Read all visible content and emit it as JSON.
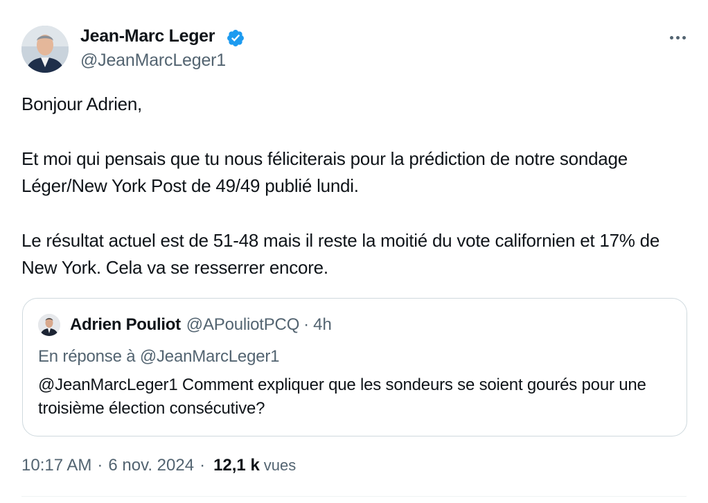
{
  "author": {
    "name": "Jean-Marc Leger",
    "handle": "@JeanMarcLeger1",
    "avatar_icon": "profile-photo",
    "verified_icon": "verified-badge-icon",
    "verified_color": "#1d9bf0"
  },
  "menu": {
    "more_icon": "more-horizontal-icon"
  },
  "tweet": {
    "paragraphs": [
      "Bonjour Adrien,",
      "Et moi qui pensais que tu nous féliciterais pour la prédiction de notre sondage Léger/New York Post de 49/49 publié lundi.",
      "Le résultat actuel est de 51-48 mais il reste la moitié du vote californien et 17% de New York. Cela va se resserrer encore."
    ]
  },
  "quoted": {
    "name": "Adrien Pouliot",
    "handle": "@APouliotPCQ",
    "separator": "·",
    "time": "4h",
    "reply_to": "En réponse à @JeanMarcLeger1",
    "text": "@JeanMarcLeger1 Comment expliquer que les sondeurs se soient gourés pour une troisième élection consécutive?"
  },
  "meta": {
    "time": "10:17 AM",
    "separator": "·",
    "date": "6 nov. 2024",
    "views_count": "12,1 k",
    "views_label": "vues"
  },
  "colors": {
    "text_primary": "#0f1419",
    "text_secondary": "#536471",
    "border": "#cfd9de"
  }
}
